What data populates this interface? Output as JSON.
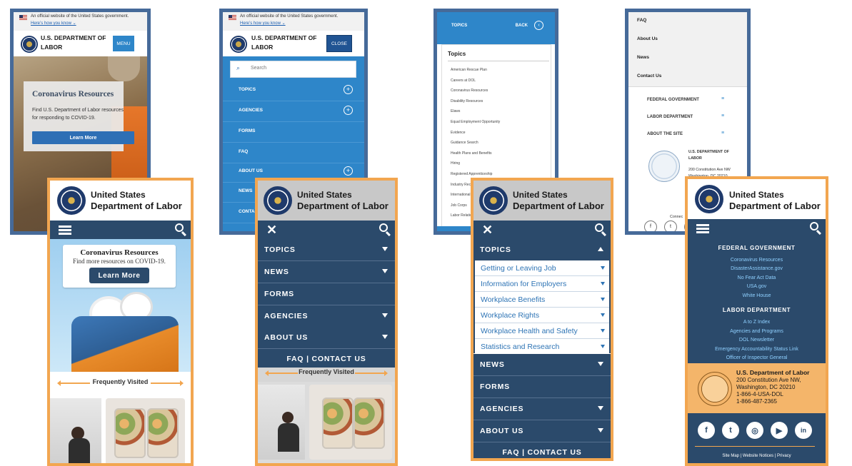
{
  "old_home": {
    "gov_banner": {
      "official": "An official website of the United States government.",
      "how": "Here’s how you know ⌄"
    },
    "dept": [
      "U.S. DEPARTMENT OF",
      "LABOR"
    ],
    "menu": "MENU",
    "hero_title": "Coronavirus Resources",
    "hero_text": "Find U.S. Department of Labor resources for responding to COVID-19.",
    "hero_button": "Learn More"
  },
  "old_menu": {
    "gov_banner": {
      "official": "An official website of the United States government.",
      "how": "Here’s how you know ⌄"
    },
    "dept": [
      "U.S. DEPARTMENT OF",
      "LABOR"
    ],
    "close": "CLOSE",
    "search_placeholder": "Search",
    "items": [
      {
        "label": "TOPICS",
        "expandable": true
      },
      {
        "label": "AGENCIES",
        "expandable": true
      },
      {
        "label": "FORMS",
        "expandable": false
      },
      {
        "label": "FAQ",
        "expandable": false
      },
      {
        "label": "ABOUT US",
        "expandable": true
      },
      {
        "label": "NEWS",
        "expandable": false
      },
      {
        "label": "CONTAC",
        "expandable": false
      }
    ]
  },
  "old_topics": {
    "header": "TOPICS",
    "back": "BACK",
    "panel_title": "Topics",
    "list": [
      "American Rescue Plan",
      "Careers at DOL",
      "Coronavirus Resources",
      "Disability Resources",
      "Elaws",
      "Equal Employment Opportunity",
      "Evidence",
      "Guidance Search",
      "Health Plans and Benefits",
      "Hiring",
      "Registered Apprenticeship",
      "Industry Rec",
      "International",
      "Job Corps",
      "Labor Relatio"
    ]
  },
  "old_footer": {
    "items": [
      "FAQ",
      "About Us",
      "News",
      "Contact Us"
    ],
    "sections": [
      "FEDERAL GOVERNMENT",
      "LABOR DEPARTMENT",
      "ABOUT THE SITE"
    ],
    "org": [
      "U.S. DEPARTMENT OF",
      "LABOR"
    ],
    "address": [
      "200 Constitution Ave NW",
      "Washington, DC 20210"
    ],
    "connect": "Connec"
  },
  "brand": {
    "l1": "United States",
    "l2": "Department of Labor"
  },
  "new_home": {
    "hero_title": "Coronavirus Resources",
    "hero_text": "Find more resources on COVID-19.",
    "hero_button": "Learn More",
    "frequently": "Frequently Visited"
  },
  "new_menu": {
    "items": [
      {
        "label": "TOPICS",
        "caret": true
      },
      {
        "label": "NEWS",
        "caret": true
      },
      {
        "label": "FORMS",
        "caret": false
      },
      {
        "label": "AGENCIES",
        "caret": true
      },
      {
        "label": "ABOUT US",
        "caret": true
      }
    ],
    "faq_contact": "FAQ | CONTACT US",
    "frequently": "Frequently Visited"
  },
  "new_topics": {
    "topics": "TOPICS",
    "sub": [
      "Getting or Leaving Job",
      "Information for Employers",
      "Workplace Benefits",
      "Workplace Rights",
      "Workplace Health and Safety",
      "Statistics and Research"
    ],
    "items": [
      {
        "label": "NEWS",
        "caret": true
      },
      {
        "label": "FORMS",
        "caret": false
      },
      {
        "label": "AGENCIES",
        "caret": true
      },
      {
        "label": "ABOUT US",
        "caret": true
      }
    ],
    "faq_contact": "FAQ | CONTACT US"
  },
  "new_footer": {
    "fed_heading": "FEDERAL GOVERNMENT",
    "fed_links": [
      "Coronavirus Resources",
      "DisasterAssistance.gov",
      "No Fear Act Data",
      "USA.gov",
      "White House"
    ],
    "labor_heading": "LABOR DEPARTMENT",
    "labor_links": [
      "A to Z Index",
      "Agencies and Programs",
      "DOL Newsletter",
      "Emergency Accountability Status Link",
      "Officer of Inspector General"
    ],
    "org": "U.S. Department of Labor",
    "address": [
      "200 Constitution Ave NW,",
      "Washington, DC 20210",
      "1-866-4-USA-DOL",
      "1-866-487-2365"
    ],
    "social": [
      "f",
      "t",
      "◎",
      "▶",
      "in"
    ],
    "bottom_links": "Site Map  |  Website Notices  |  Privacy"
  },
  "colors": {
    "old_frame": "#466a99",
    "new_frame": "#f2a650",
    "navy": "#2b4a6b",
    "old_blue": "#2e86c9"
  }
}
